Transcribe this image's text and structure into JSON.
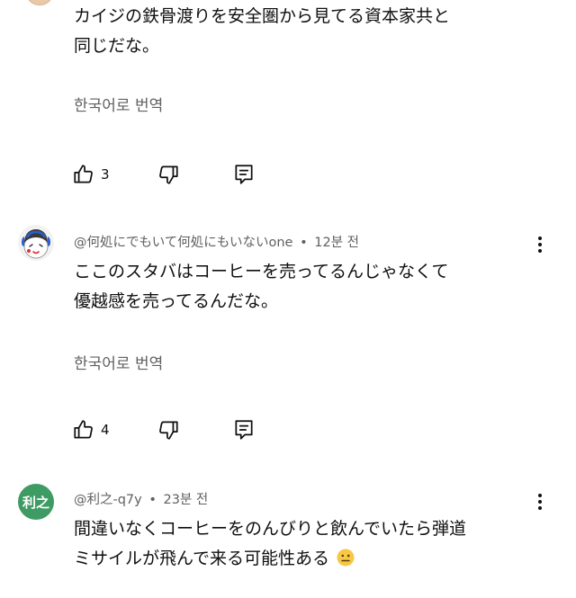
{
  "comments": [
    {
      "text_lines": [
        "カイジの鉄骨渡りを安全圏から見てる資本家共と",
        "同じだな。"
      ],
      "translate_label": "한국어로 번역",
      "like_count": "3"
    },
    {
      "author": "@何処にでもいて何処にもいないone",
      "time": "12분 전",
      "text_lines": [
        "ここのスタバはコーヒーを売ってるんじゃなくて",
        "優越感を売ってるんだな。"
      ],
      "translate_label": "한국어로 번역",
      "like_count": "4"
    },
    {
      "author": "@利之-q7y",
      "time": "23분 전",
      "avatar_text": "利之",
      "text_lines": [
        "間違いなくコーヒーをのんびりと飲んでいたら弾道",
        "ミサイルが飛んで来る可能性ある"
      ],
      "emoji": "neutral-face-emoji"
    }
  ],
  "separator": "•",
  "colors": {
    "text": "#0f0f0f",
    "secondary": "#606060",
    "avatar_green": "#3e9b63"
  }
}
